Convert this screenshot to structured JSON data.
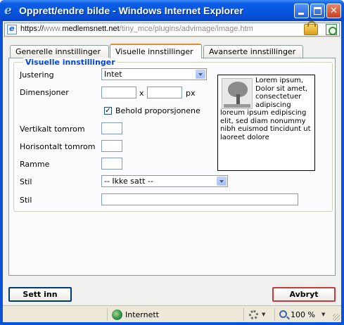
{
  "window": {
    "title": "Opprett/endre bilde - Windows Internet Explorer",
    "icon": "ie-icon"
  },
  "address": {
    "scheme": "https://",
    "prefix": "www.",
    "host": "medlemsnett.net",
    "path": "/tiny_mce/plugins/advimage/image.htm"
  },
  "tabs": [
    {
      "label": "Generelle innstillinger",
      "active": false
    },
    {
      "label": "Visuelle innstillinger",
      "active": true
    },
    {
      "label": "Avanserte innstillinger",
      "active": false
    }
  ],
  "fieldset": {
    "legend": "Visuelle innstillinger",
    "justering_label": "Justering",
    "justering_value": "Intet",
    "dimensjoner_label": "Dimensjoner",
    "dim_width": "",
    "dim_sep": "x",
    "dim_height": "",
    "dim_unit": "px",
    "constrain_label": "Behold proporsjonene",
    "constrain_checked": true,
    "vspace_label": "Vertikalt tomrom",
    "vspace_value": "",
    "hspace_label": "Horisontalt tomrom",
    "hspace_value": "",
    "border_label": "Ramme",
    "border_value": "",
    "class_label": "Stil",
    "class_value": "-- Ikke satt --",
    "style_label": "Stil",
    "style_value": "",
    "preview_text": "Lorem ipsum, Dolor sit amet, consectetuer adipiscing loreum ipsum edipiscing elit, sed diam nonummy nibh euismod tincidunt ut laoreet dolore"
  },
  "buttons": {
    "insert": "Sett inn",
    "cancel": "Avbryt"
  },
  "status": {
    "zone": "Internett",
    "zoom": "100 %"
  },
  "colors": {
    "titlebar": "#0854de",
    "legend": "#0046d5",
    "active_tab_accent": "#e68b2c",
    "cancel_border": "#c43b3b"
  }
}
